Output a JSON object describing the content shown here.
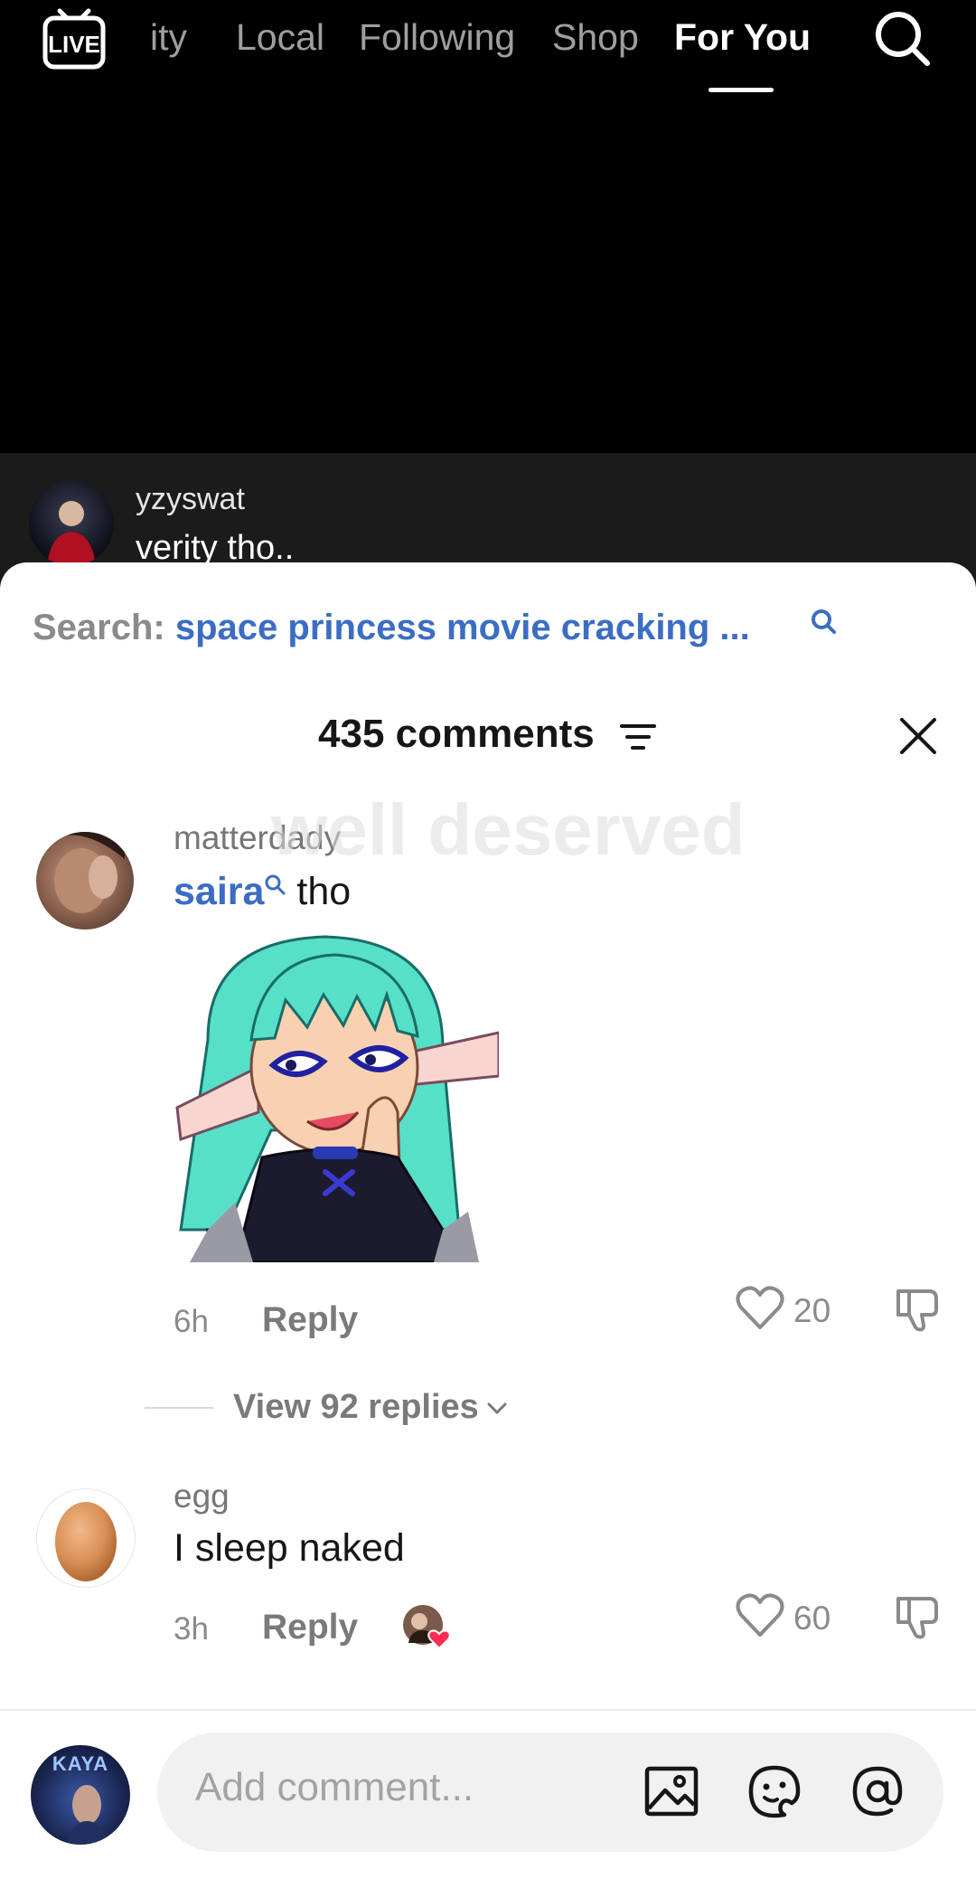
{
  "topnav": {
    "live_label": "LIVE",
    "tabs": [
      {
        "label": "ity",
        "active": false
      },
      {
        "label": "Local",
        "active": false
      },
      {
        "label": "Following",
        "active": false
      },
      {
        "label": "Shop",
        "active": false
      },
      {
        "label": "For You",
        "active": true
      }
    ]
  },
  "overlay_comment": {
    "username": "yzyswat",
    "text": "verity tho.."
  },
  "sheet": {
    "search_label": "Search:",
    "search_query": "space princess movie cracking ...",
    "comment_count": "435 comments",
    "watermark_text": "well deserved"
  },
  "comments": [
    {
      "username": "matterdady",
      "mention": "saira",
      "text": "tho",
      "time": "6h",
      "reply_label": "Reply",
      "likes": "20",
      "view_replies": "View 92 replies"
    },
    {
      "username": "egg",
      "text": "I sleep naked",
      "time": "3h",
      "reply_label": "Reply",
      "likes": "60"
    }
  ],
  "composer": {
    "avatar_label": "KAYA",
    "placeholder": "Add comment..."
  },
  "colors": {
    "accent_blue": "#3b6dc5",
    "creator_heart": "#fe2c55"
  }
}
